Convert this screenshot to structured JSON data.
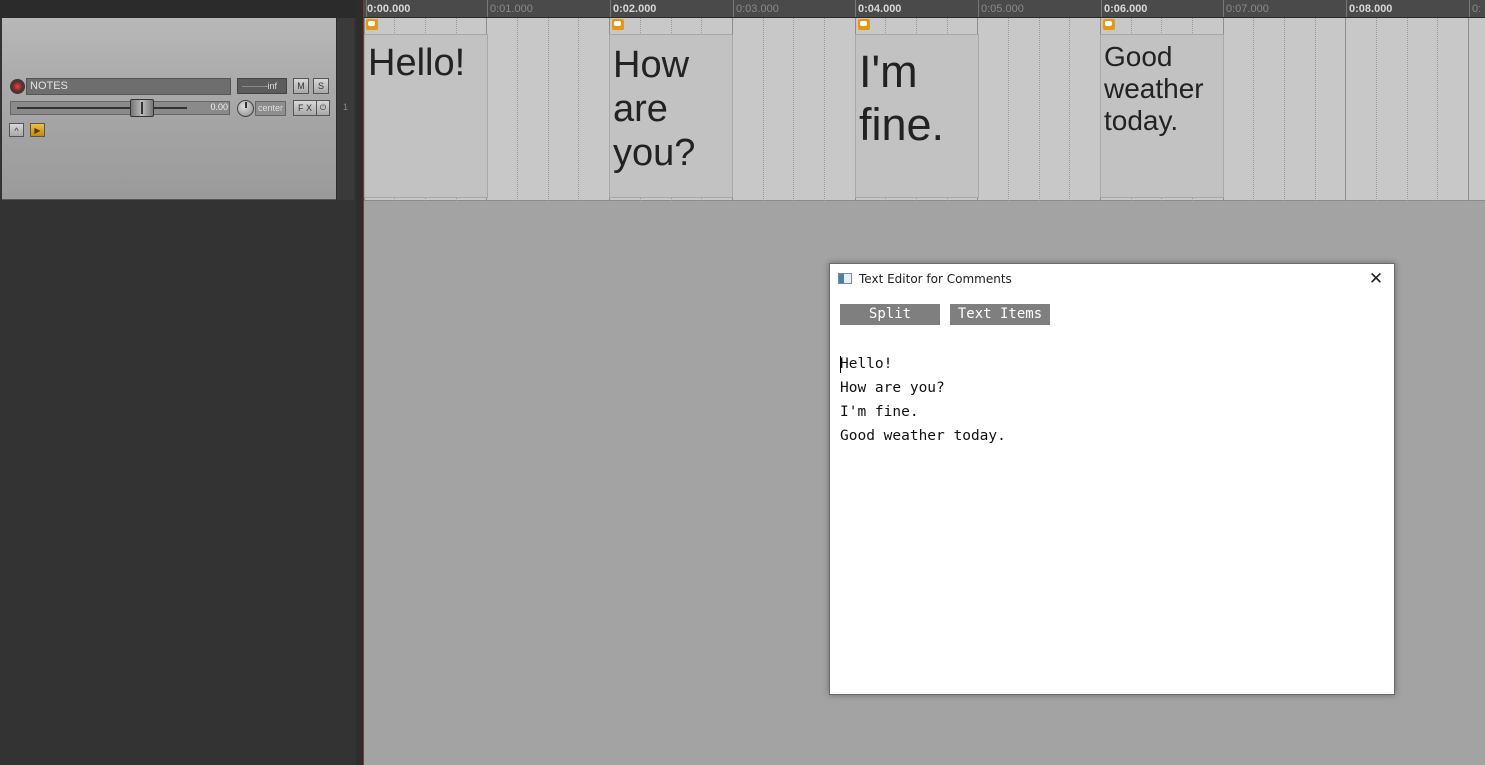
{
  "track": {
    "name": "NOTES",
    "volume_readout": "-inf",
    "mute_label": "M",
    "solo_label": "S",
    "fader_value": "0.00",
    "pan_label": "center",
    "fx_label": "F X",
    "fx_power_label": "⏻",
    "env_label": "^",
    "play_label": "▶",
    "number": "1"
  },
  "ruler": {
    "major": [
      "0:00.000",
      "0:02.000",
      "0:04.000",
      "0:06.000",
      "0:08.000"
    ],
    "minor": [
      "0:01.000",
      "0:03.000",
      "0:05.000",
      "0:07.000"
    ],
    "trailing": "0:"
  },
  "items": [
    {
      "text": "Hello!"
    },
    {
      "text": "How are you?"
    },
    {
      "text": "I'm fine."
    },
    {
      "text": "Good weather today."
    }
  ],
  "dialog": {
    "title": "Text Editor for Comments",
    "close_label": "✕",
    "split_label": "Split",
    "text_items_label": "Text Items",
    "lines": [
      "Hello!",
      "How are you?",
      "I'm fine.",
      "Good weather today."
    ]
  },
  "colors": {
    "note_icon": "#e39a12",
    "button_bg": "#7f7f7f",
    "lane_bg": "#c8c8c8",
    "arrange_bg": "#a3a3a3"
  }
}
